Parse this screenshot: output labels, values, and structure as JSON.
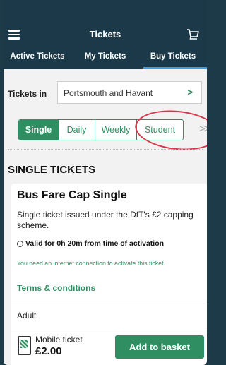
{
  "header": {
    "title": "Tickets"
  },
  "tabs": [
    {
      "label": "Active Tickets",
      "active": false
    },
    {
      "label": "My Tickets",
      "active": false
    },
    {
      "label": "Buy Tickets",
      "active": true
    }
  ],
  "location": {
    "label": "Tickets in",
    "value": "Portsmouth and Havant"
  },
  "ticket_types": [
    {
      "label": "Single",
      "active": true
    },
    {
      "label": "Daily",
      "active": false
    },
    {
      "label": "Weekly",
      "active": false
    },
    {
      "label": "Student",
      "active": false
    }
  ],
  "more_indicator": ">>",
  "section_title": "SINGLE TICKETS",
  "card": {
    "title": "Bus Fare Cap Single",
    "description": "Single ticket issued under the DfT's £2 capping scheme.",
    "validity": "Valid for 0h 20m from time of activation",
    "notice": "You need an internet connection to activate this ticket.",
    "terms_link": "Terms & conditions",
    "passenger_type": "Adult",
    "delivery": "Mobile ticket",
    "price": "£2.00",
    "button": "Add to basket"
  },
  "colors": {
    "header_bg": "#1b3949",
    "accent_green": "#2f8f62",
    "tab_indicator": "#3aa0e6",
    "annotation_red": "#d9364c"
  }
}
